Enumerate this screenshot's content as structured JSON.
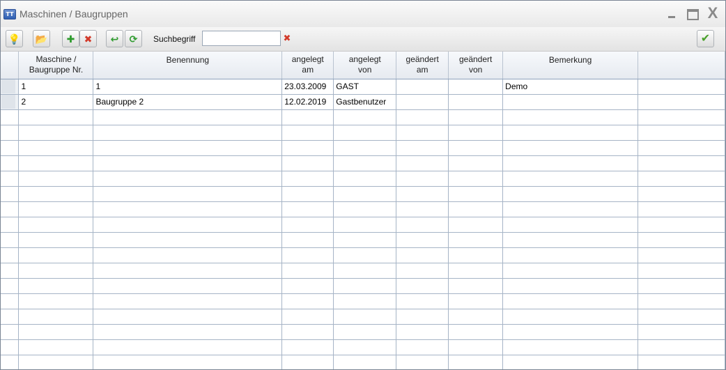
{
  "window": {
    "title": "Maschinen / Baugruppen",
    "app_icon_text": "TT",
    "close_glyph": "X"
  },
  "toolbar": {
    "search_label": "Suchbegriff",
    "search_value": "",
    "icons": {
      "hint": "lightbulb-icon",
      "open": "folder-icon",
      "add": "add-icon",
      "delete": "delete-icon",
      "undo": "undo-icon",
      "refresh": "refresh-icon",
      "clear_search": "clear-icon",
      "confirm": "checkmark-icon"
    }
  },
  "table": {
    "columns": [
      {
        "line1": "Maschine /",
        "line2": "Baugruppe Nr."
      },
      {
        "line1": "Benennung",
        "line2": ""
      },
      {
        "line1": "angelegt",
        "line2": "am"
      },
      {
        "line1": "angelegt",
        "line2": "von"
      },
      {
        "line1": "geändert",
        "line2": "am"
      },
      {
        "line1": "geändert",
        "line2": "von"
      },
      {
        "line1": "Bemerkung",
        "line2": ""
      },
      {
        "line1": "",
        "line2": ""
      }
    ],
    "rows": [
      [
        "1",
        "1",
        "23.03.2009",
        "GAST",
        "",
        "",
        "Demo",
        ""
      ],
      [
        "2",
        "Baugruppe 2",
        "12.02.2019",
        "Gastbenutzer",
        "",
        "",
        "",
        ""
      ]
    ],
    "empty_rows": 17
  },
  "colors": {
    "accent": "#2f5fb3",
    "grid_line": "#a6b4c6"
  }
}
